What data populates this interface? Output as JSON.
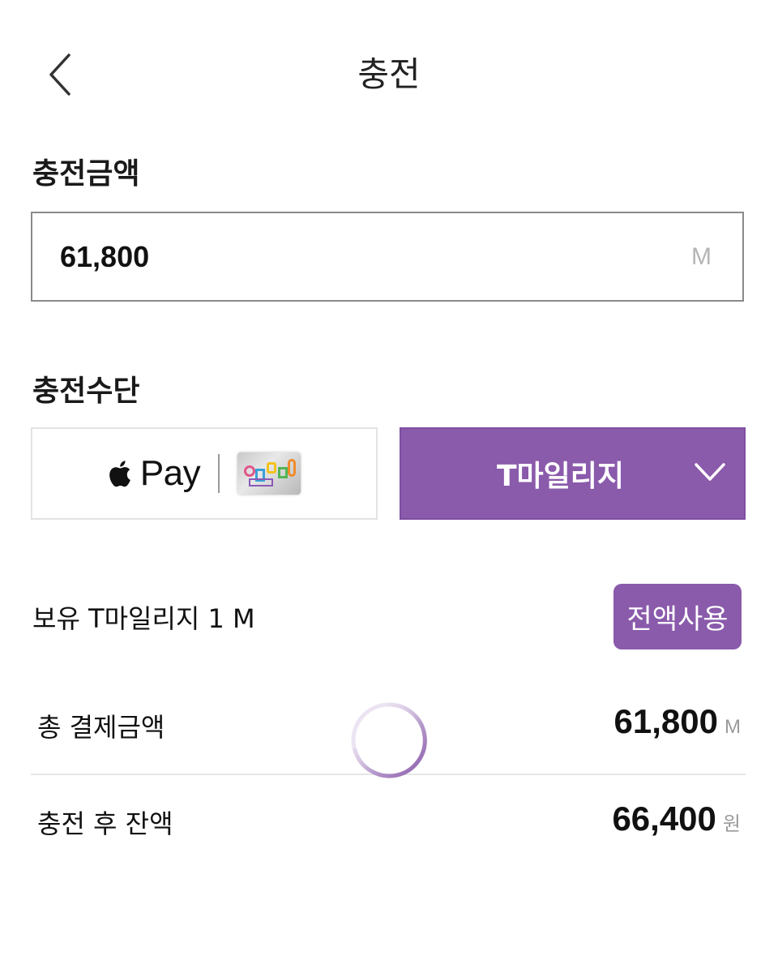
{
  "header": {
    "title": "충전",
    "back_icon": "chevron-left-icon"
  },
  "amount_section": {
    "label": "충전금액",
    "value": "61,800",
    "unit": "M"
  },
  "method_section": {
    "label": "충전수단",
    "apple_pay_text": "Pay",
    "apple_icon": "apple-icon",
    "selected_method": "T마일리지",
    "dropdown_icon": "chevron-down-icon"
  },
  "mileage": {
    "label": "보유 T마일리지 1 M",
    "use_all_button": "전액사용"
  },
  "totals": {
    "payment_label": "총 결제금액",
    "payment_value": "61,800",
    "payment_unit": "M",
    "balance_label": "충전 후 잔액",
    "balance_value": "66,400",
    "balance_unit": "원"
  },
  "colors": {
    "accent": "#8a5aab",
    "border": "#8a8a8a",
    "muted": "#b5b5b5"
  },
  "loading_indicator": "spinner-icon"
}
